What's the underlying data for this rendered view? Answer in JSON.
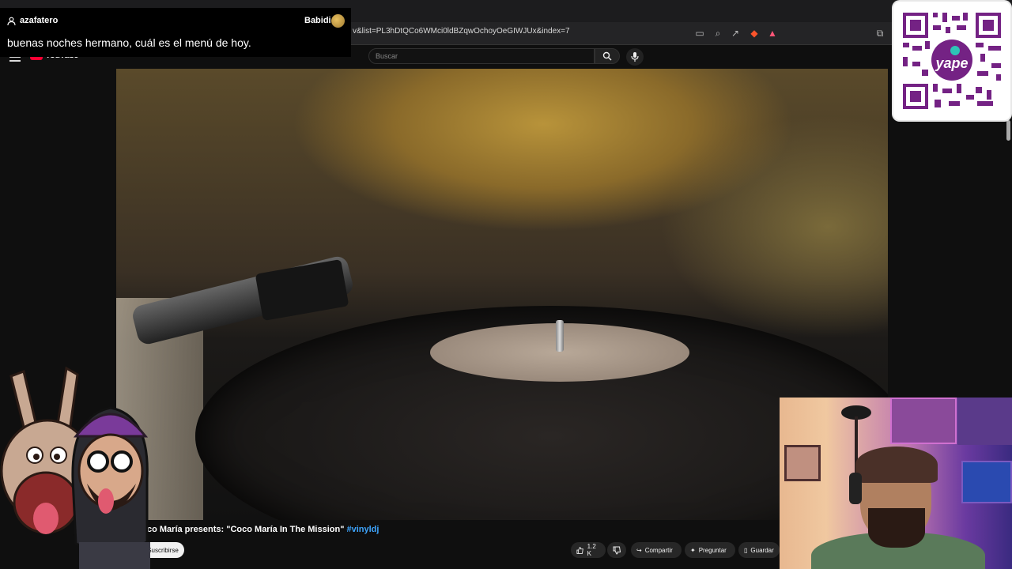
{
  "browser": {
    "url": "v&list=PL3hDtQCo6WMci0ldBZqwOchoyOeGIWJUx&index=7"
  },
  "youtube": {
    "logo_text": "YouTube",
    "search_placeholder": "Buscar",
    "video_title_prefix": "co María presents: \"Coco María In The Mission\"",
    "video_hashtag": "#vinyldj",
    "subscribe_label": "Suscribirse",
    "likes": "1.2 K",
    "share_label": "Compartir",
    "ask_label": "Preguntar",
    "save_label": "Guardar"
  },
  "chat": {
    "username": "azafatero",
    "badge_name": "Babidi",
    "message": "buenas noches hermano, cuál es el menú de hoy."
  },
  "qr": {
    "brand": "yape",
    "accent_color": "#742284"
  },
  "colors": {
    "brand_red": "#ff0033",
    "link_blue": "#3ea6ff",
    "background": "#0f0f0f"
  }
}
